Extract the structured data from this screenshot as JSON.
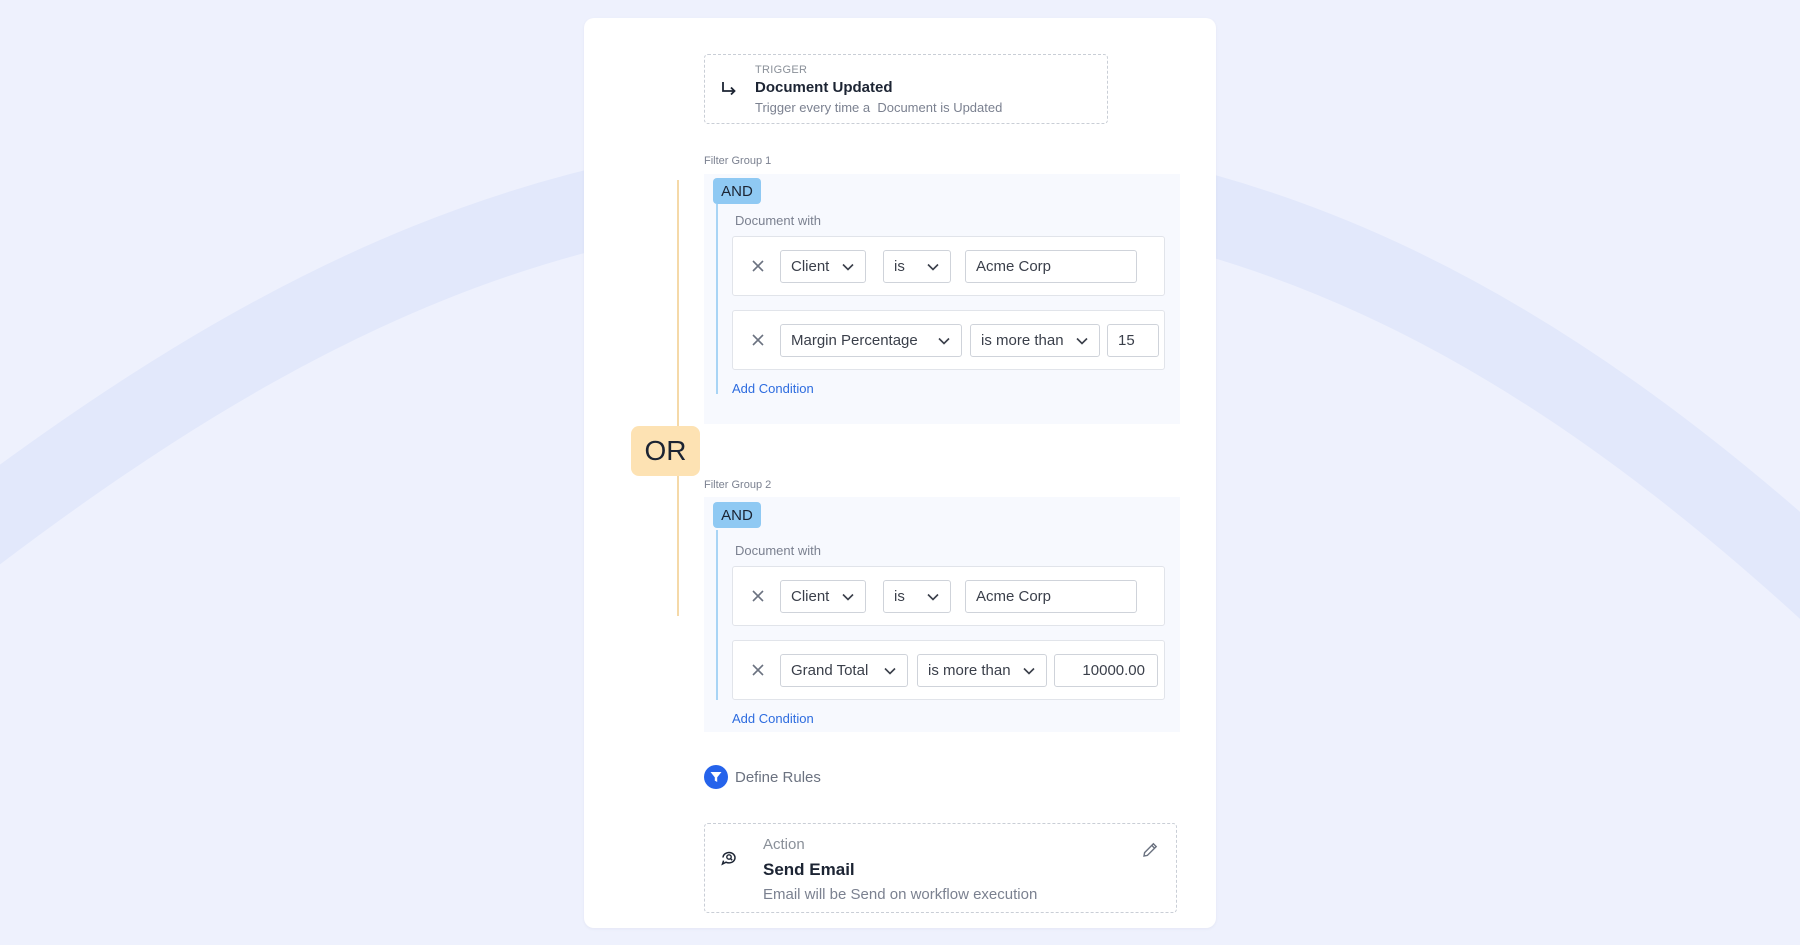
{
  "trigger": {
    "label": "TRIGGER",
    "title": "Document Updated",
    "description": "Trigger every time a  Document is Updated"
  },
  "or_label": "OR",
  "groups": [
    {
      "label": "Filter Group 1",
      "operator": "AND",
      "subject": "Document with",
      "conditions": [
        {
          "field": "Client",
          "op": "is",
          "value": "Acme Corp"
        },
        {
          "field": "Margin Percentage",
          "op": "is more than",
          "value": "15"
        }
      ],
      "add_label": "Add Condition"
    },
    {
      "label": "Filter Group 2",
      "operator": "AND",
      "subject": "Document with",
      "conditions": [
        {
          "field": "Client",
          "op": "is",
          "value": "Acme Corp"
        },
        {
          "field": "Grand Total",
          "op": "is more than",
          "value": "10000.00"
        }
      ],
      "add_label": "Add Condition"
    }
  ],
  "define_rules": {
    "label": "Define Rules",
    "icon": "funnel-icon"
  },
  "action": {
    "label": "Action",
    "title": "Send Email",
    "description": "Email will be Send on workflow execution",
    "icon": "chat-search-icon",
    "edit_icon": "pencil-icon"
  },
  "colors": {
    "background": "#eef1fd",
    "or_badge": "#fde2b3",
    "and_badge": "#8fc9f3",
    "link": "#2d6cdf",
    "define_icon": "#2563eb"
  }
}
